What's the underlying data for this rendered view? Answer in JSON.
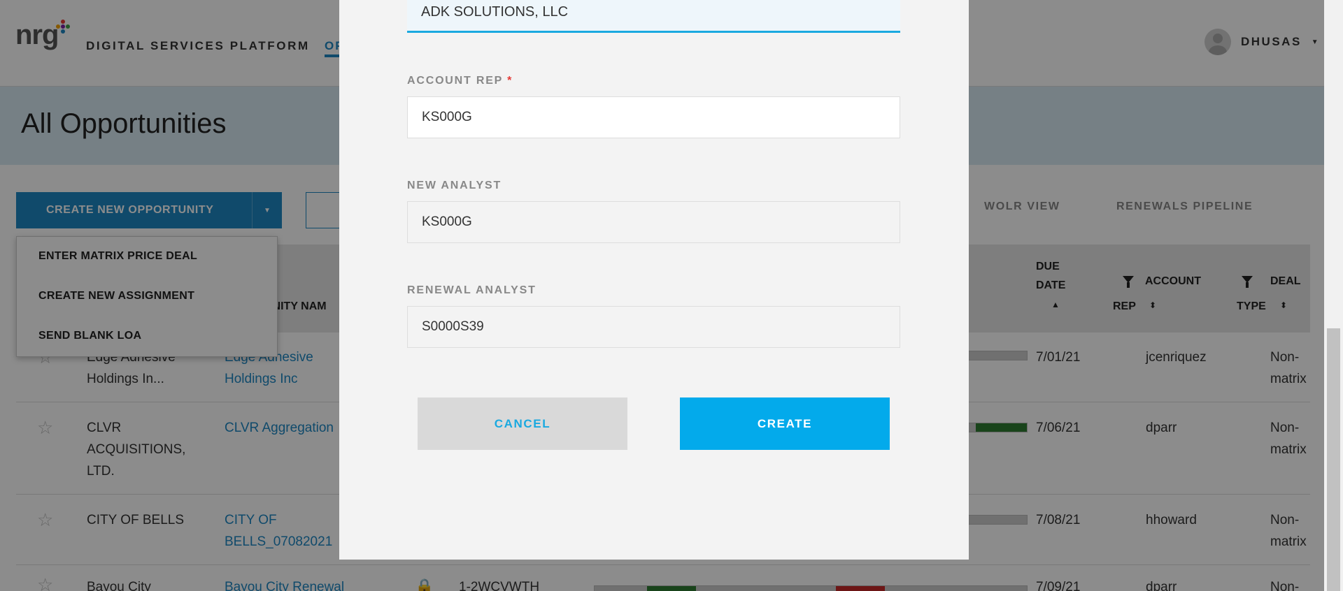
{
  "header": {
    "logo_text": "nrg",
    "platform_title": "DIGITAL SERVICES PLATFORM",
    "nav_tab_partial": "OP",
    "user_name": "DHUSAS"
  },
  "page": {
    "title": "All Opportunities"
  },
  "toolbar": {
    "create_label": "CREATE NEW OPPORTUNITY",
    "views": [
      "WOLR VIEW",
      "RENEWALS PIPELINE"
    ]
  },
  "create_menu": {
    "items": [
      "ENTER MATRIX PRICE DEAL",
      "CREATE NEW ASSIGNMENT",
      "SEND BLANK LOA"
    ]
  },
  "table": {
    "headers": {
      "opportunity_name_partial": "UNITY NAM",
      "due_date_line1": "DUE",
      "due_date_line2": "DATE",
      "account_rep_line1": "ACCOUNT",
      "account_rep_line2": "REP",
      "deal_type_line1": "DEAL",
      "deal_type_line2": "TYPE"
    },
    "rows": [
      {
        "account": "Edge Adhesive Holdings In...",
        "opportunity": "Edge Adhesive Holdings Inc",
        "due_date": "7/01/21",
        "rep": "jcenriquez",
        "deal_type": "Non-matrix"
      },
      {
        "account": "CLVR ACQUISITIONS, LTD.",
        "opportunity": "CLVR Aggregation",
        "due_date": "7/06/21",
        "rep": "dparr",
        "deal_type": "Non-matrix"
      },
      {
        "account": "CITY OF BELLS",
        "opportunity": "CITY OF BELLS_07082021",
        "due_date": "7/08/21",
        "rep": "hhoward",
        "deal_type": "Non-matrix"
      },
      {
        "account": "Bayou City",
        "opportunity": "Bayou City Renewal",
        "order_id": "1-2WCVWTH",
        "due_date": "7/09/21",
        "rep": "dparr",
        "deal_type": "Non-"
      }
    ]
  },
  "modal": {
    "company_value": "ADK SOLUTIONS, LLC",
    "account_rep_label": "ACCOUNT REP",
    "account_rep_required": "*",
    "account_rep_value": "KS000G",
    "new_analyst_label": "NEW ANALYST",
    "new_analyst_value": "KS000G",
    "renewal_analyst_label": "RENEWAL ANALYST",
    "renewal_analyst_value": "S0000S39",
    "cancel_label": "CANCEL",
    "create_label": "CREATE"
  },
  "colors": {
    "brand_blue": "#1e88c4",
    "create_button": "#03aaeb",
    "required_red": "#e53935",
    "progress_green": "#2e7d32"
  }
}
